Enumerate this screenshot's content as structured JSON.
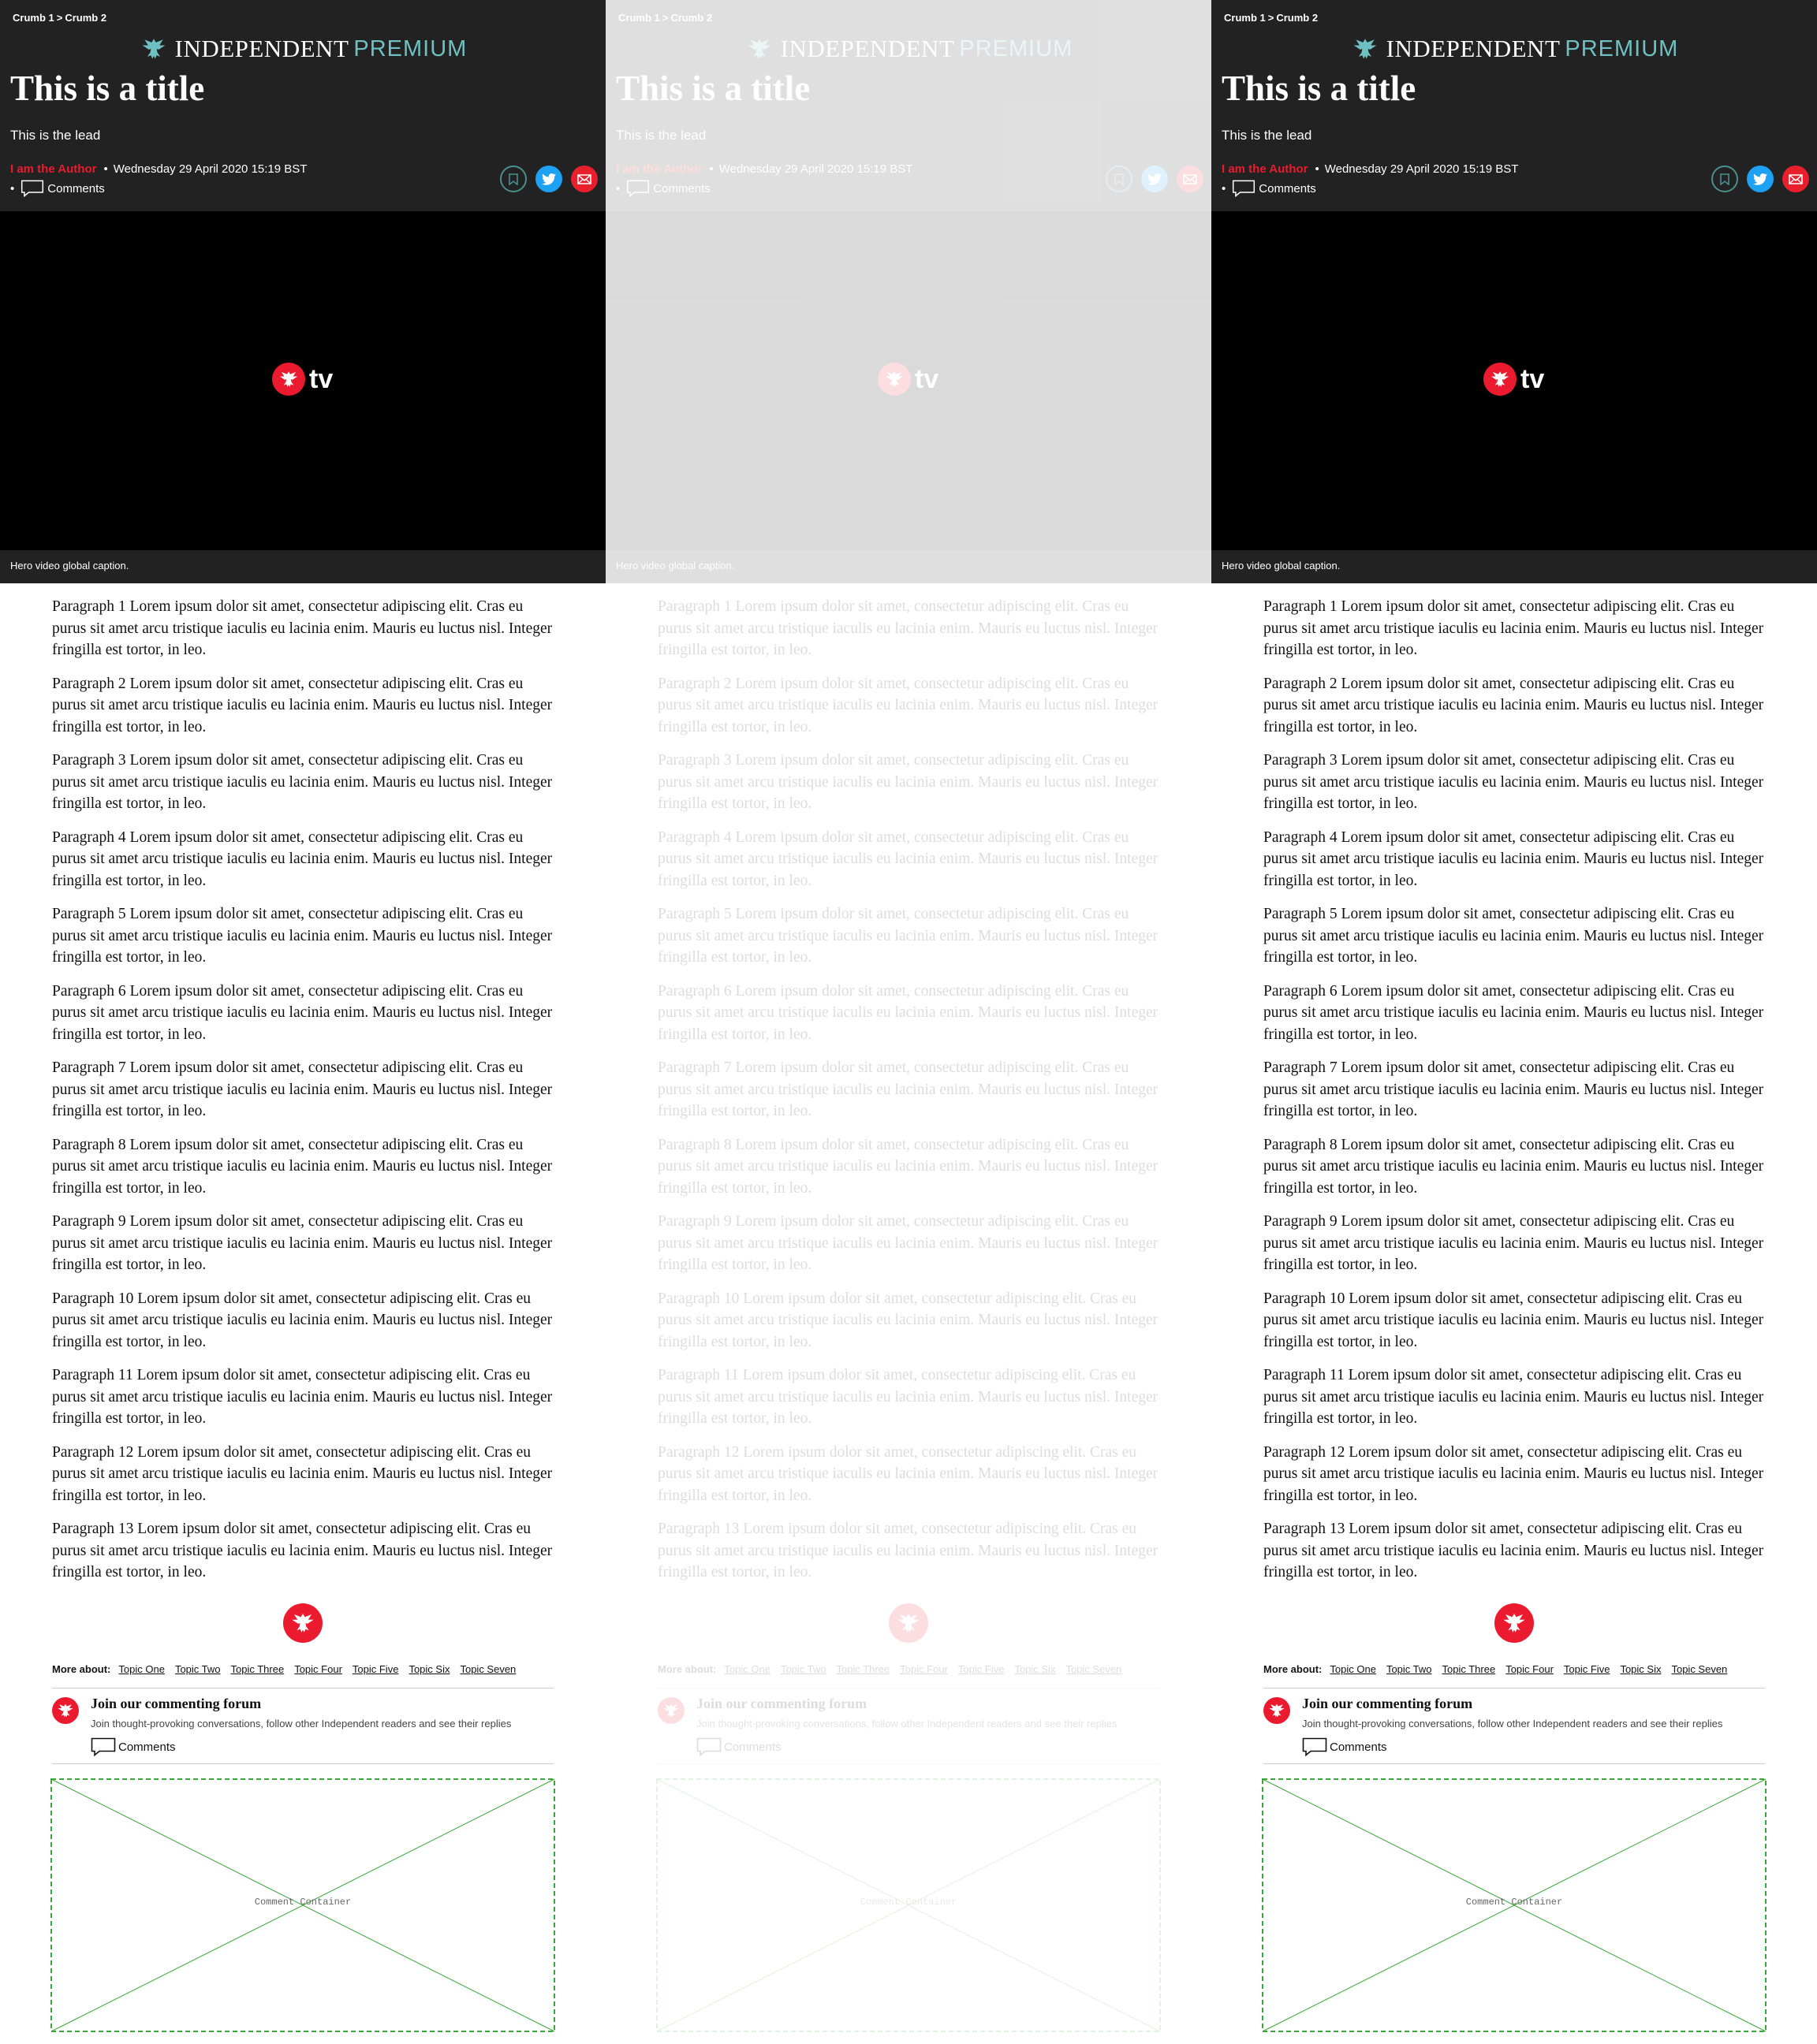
{
  "breadcrumb": {
    "crumbs": [
      "Crumb 1",
      "Crumb 2"
    ],
    "separator": ">"
  },
  "masthead": {
    "brand": "INDEPENDENT",
    "tier": "PREMIUM",
    "logo_icon": "eagle-icon",
    "tier_color": "#6ec0c3"
  },
  "article": {
    "title": "This is a title",
    "lead": "This is the lead",
    "author": "I am the Author",
    "date": "Wednesday 29 April 2020 15:19 BST",
    "bullet": "•",
    "comments_label": "Comments"
  },
  "share": {
    "icons": [
      "bookmark-icon",
      "twitter-icon",
      "email-icon"
    ]
  },
  "video": {
    "logo_text": "tv",
    "caption": "Hero video global caption."
  },
  "paragraphs": [
    "Paragraph 1 Lorem ipsum dolor sit amet, consectetur adipiscing elit. Cras eu purus sit amet arcu tristique iaculis eu lacinia enim. Mauris eu luctus nisl. Integer fringilla est tortor, in leo.",
    "Paragraph 2 Lorem ipsum dolor sit amet, consectetur adipiscing elit. Cras eu purus sit amet arcu tristique iaculis eu lacinia enim. Mauris eu luctus nisl. Integer fringilla est tortor, in leo.",
    "Paragraph 3 Lorem ipsum dolor sit amet, consectetur adipiscing elit. Cras eu purus sit amet arcu tristique iaculis eu lacinia enim. Mauris eu luctus nisl. Integer fringilla est tortor, in leo.",
    "Paragraph 4 Lorem ipsum dolor sit amet, consectetur adipiscing elit. Cras eu purus sit amet arcu tristique iaculis eu lacinia enim. Mauris eu luctus nisl. Integer fringilla est tortor, in leo.",
    "Paragraph 5 Lorem ipsum dolor sit amet, consectetur adipiscing elit. Cras eu purus sit amet arcu tristique iaculis eu lacinia enim. Mauris eu luctus nisl. Integer fringilla est tortor, in leo.",
    "Paragraph 6 Lorem ipsum dolor sit amet, consectetur adipiscing elit. Cras eu purus sit amet arcu tristique iaculis eu lacinia enim. Mauris eu luctus nisl. Integer fringilla est tortor, in leo.",
    "Paragraph 7 Lorem ipsum dolor sit amet, consectetur adipiscing elit. Cras eu purus sit amet arcu tristique iaculis eu lacinia enim. Mauris eu luctus nisl. Integer fringilla est tortor, in leo.",
    "Paragraph 8 Lorem ipsum dolor sit amet, consectetur adipiscing elit. Cras eu purus sit amet arcu tristique iaculis eu lacinia enim. Mauris eu luctus nisl. Integer fringilla est tortor, in leo.",
    "Paragraph 9 Lorem ipsum dolor sit amet, consectetur adipiscing elit. Cras eu purus sit amet arcu tristique iaculis eu lacinia enim. Mauris eu luctus nisl. Integer fringilla est tortor, in leo.",
    "Paragraph 10 Lorem ipsum dolor sit amet, consectetur adipiscing elit. Cras eu purus sit amet arcu tristique iaculis eu lacinia enim. Mauris eu luctus nisl. Integer fringilla est tortor, in leo.",
    "Paragraph 11 Lorem ipsum dolor sit amet, consectetur adipiscing elit. Cras eu purus sit amet arcu tristique iaculis eu lacinia enim. Mauris eu luctus nisl. Integer fringilla est tortor, in leo.",
    "Paragraph 12 Lorem ipsum dolor sit amet, consectetur adipiscing elit. Cras eu purus sit amet arcu tristique iaculis eu lacinia enim. Mauris eu luctus nisl. Integer fringilla est tortor, in leo.",
    "Paragraph 13 Lorem ipsum dolor sit amet, consectetur adipiscing elit. Cras eu purus sit amet arcu tristique iaculis eu lacinia enim. Mauris eu luctus nisl. Integer fringilla est tortor, in leo."
  ],
  "more_about": {
    "label": "More about:",
    "topics": [
      "Topic One",
      "Topic Two",
      "Topic Three",
      "Topic Four",
      "Topic Five",
      "Topic Six",
      "Topic Seven"
    ]
  },
  "forum": {
    "title": "Join our commenting forum",
    "subtitle": "Join thought-provoking conversations, follow other Independent readers and see their replies",
    "comments_label": "Comments"
  },
  "comment_container": {
    "label": "Comment Container"
  },
  "colors": {
    "header_bg": "#222222",
    "brand_red": "#ec1a2e",
    "twitter_blue": "#1da1f2",
    "placeholder_green": "#3aa63a"
  }
}
